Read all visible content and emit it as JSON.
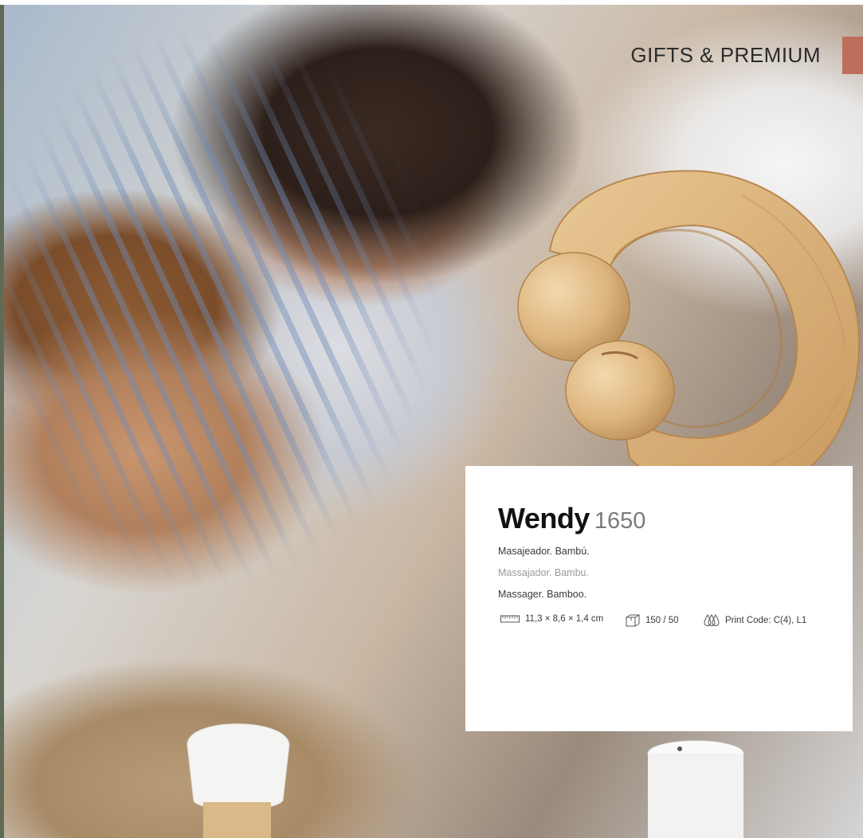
{
  "header": {
    "section_title": "GIFTS & PREMIUM",
    "tab_color": "#bd6f5c"
  },
  "product": {
    "name": "Wendy",
    "code": "1650",
    "descriptions": {
      "es": "Masajeador. Bambú.",
      "pt": "Massajador. Bambu.",
      "en": "Massager. Bamboo."
    },
    "specs": {
      "dimensions": "11,3 × 8,6 × 1,4 cm",
      "packaging": "150 / 50",
      "print_code": "Print Code: C(4), L1"
    }
  },
  "icons": {
    "dimensions": "ruler-icon",
    "packaging": "box-icon",
    "print": "print-drops-icon"
  },
  "colors": {
    "accent": "#bd6f5c",
    "bamboo": "#dcb57e",
    "text_dark": "#121212",
    "text_code": "#7a7a7a"
  }
}
